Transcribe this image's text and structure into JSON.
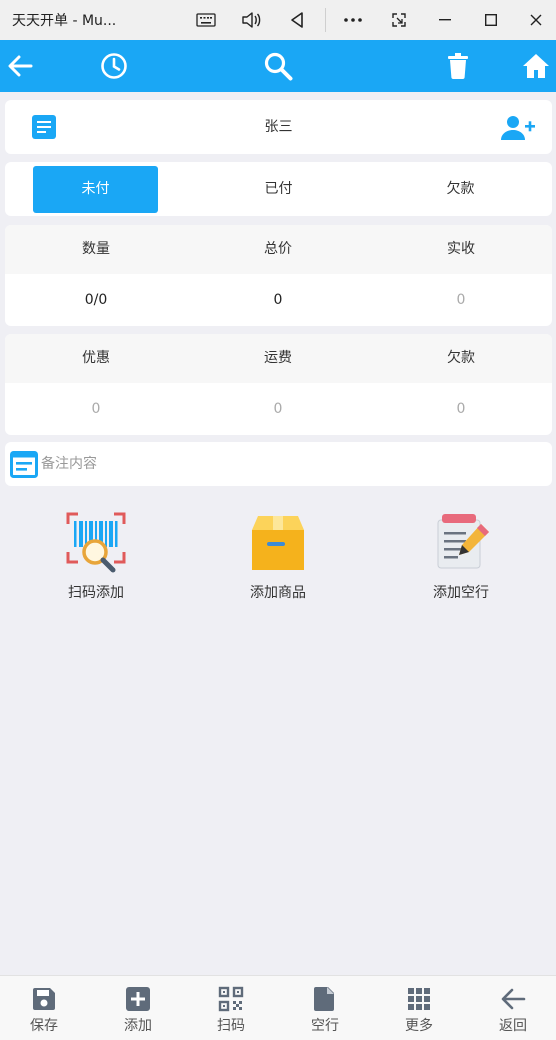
{
  "window": {
    "title": "天天开单 - Mu..."
  },
  "appbar": {
    "icons": [
      "back-arrow-icon",
      "history-clock-icon",
      "search-icon",
      "trash-icon",
      "home-icon"
    ],
    "color": "#1aa7f5"
  },
  "customer": {
    "name": "张三"
  },
  "tabs": [
    {
      "label": "未付",
      "active": true
    },
    {
      "label": "已付",
      "active": false
    },
    {
      "label": "欠款",
      "active": false
    }
  ],
  "summary1": {
    "headers": [
      "数量",
      "总价",
      "实收"
    ],
    "values": [
      "0/0",
      "0",
      "0"
    ]
  },
  "summary2": {
    "headers": [
      "优惠",
      "运费",
      "欠款"
    ],
    "values": [
      "0",
      "0",
      "0"
    ]
  },
  "note": {
    "placeholder": "备注内容"
  },
  "actions": [
    {
      "label": "扫码添加",
      "icon": "barcode-scan-icon"
    },
    {
      "label": "添加商品",
      "icon": "product-box-icon"
    },
    {
      "label": "添加空行",
      "icon": "notepad-pencil-icon"
    }
  ],
  "bottom_nav": [
    {
      "label": "保存",
      "icon": "save-icon"
    },
    {
      "label": "添加",
      "icon": "add-square-icon"
    },
    {
      "label": "扫码",
      "icon": "qr-code-icon"
    },
    {
      "label": "空行",
      "icon": "document-icon"
    },
    {
      "label": "更多",
      "icon": "grid-more-icon"
    },
    {
      "label": "返回",
      "icon": "back-arrow-icon"
    }
  ]
}
